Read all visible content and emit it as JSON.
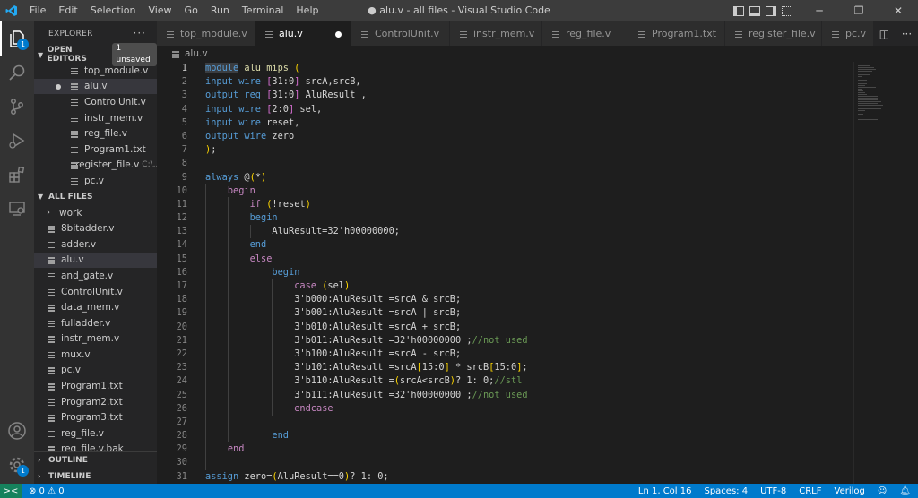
{
  "window": {
    "title": "● alu.v - all files - Visual Studio Code",
    "menu": [
      "File",
      "Edit",
      "Selection",
      "View",
      "Go",
      "Run",
      "Terminal",
      "Help"
    ]
  },
  "activity_bar": {
    "items": [
      "explorer-icon",
      "search-icon",
      "source-control-icon",
      "run-debug-icon",
      "extensions-icon",
      "remote-explorer-icon"
    ],
    "explorer_badge": "1",
    "bottom": [
      "accounts-icon",
      "settings-gear-icon"
    ],
    "settings_badge": "1"
  },
  "sidebar": {
    "header": "EXPLORER",
    "more": "···",
    "open_editors": {
      "label": "OPEN EDITORS",
      "badge": "1 unsaved",
      "items": [
        {
          "name": "top_module.v",
          "desc": ""
        },
        {
          "name": "alu.v",
          "desc": ""
        },
        {
          "name": "ControlUnit.v",
          "desc": ""
        },
        {
          "name": "instr_mem.v",
          "desc": ""
        },
        {
          "name": "reg_file.v",
          "desc": ""
        },
        {
          "name": "Program1.txt",
          "desc": ""
        },
        {
          "name": "register_file.v",
          "desc": "C:\\..."
        },
        {
          "name": "pc.v",
          "desc": ""
        }
      ]
    },
    "all_files": {
      "label": "ALL FILES",
      "items": [
        "work",
        "8bitadder.v",
        "adder.v",
        "alu.v",
        "and_gate.v",
        "ControlUnit.v",
        "data_mem.v",
        "fulladder.v",
        "instr_mem.v",
        "mux.v",
        "pc.v",
        "Program1.txt",
        "Program2.txt",
        "Program3.txt",
        "reg_file.v",
        "reg_file.v.bak"
      ]
    },
    "outline": "OUTLINE",
    "timeline": "TIMELINE"
  },
  "tabs": [
    "top_module.v",
    "alu.v",
    "ControlUnit.v",
    "instr_mem.v",
    "reg_file.v",
    "Program1.txt",
    "register_file.v",
    "pc.v"
  ],
  "breadcrumb": "alu.v",
  "editor": {
    "line_numbers": [
      "1",
      "2",
      "3",
      "4",
      "5",
      "6",
      "7",
      "8",
      "9",
      "10",
      "11",
      "12",
      "13",
      "14",
      "15",
      "16",
      "17",
      "18",
      "19",
      "20",
      "21",
      "22",
      "23",
      "24",
      "25",
      "26",
      "27",
      "28",
      "29",
      "30",
      "31"
    ]
  },
  "status_bar": {
    "remote": "><",
    "problems": "⊗ 0 ⚠ 0",
    "position": "Ln 1, Col 16",
    "spaces": "Spaces: 4",
    "encoding": "UTF-8",
    "eol": "CRLF",
    "language": "Verilog"
  },
  "colors": {
    "accent": "#007acc",
    "keyword": "#569cd6",
    "control": "#c586c0",
    "comment": "#6a9955",
    "module_name": "#dcdcaa"
  }
}
